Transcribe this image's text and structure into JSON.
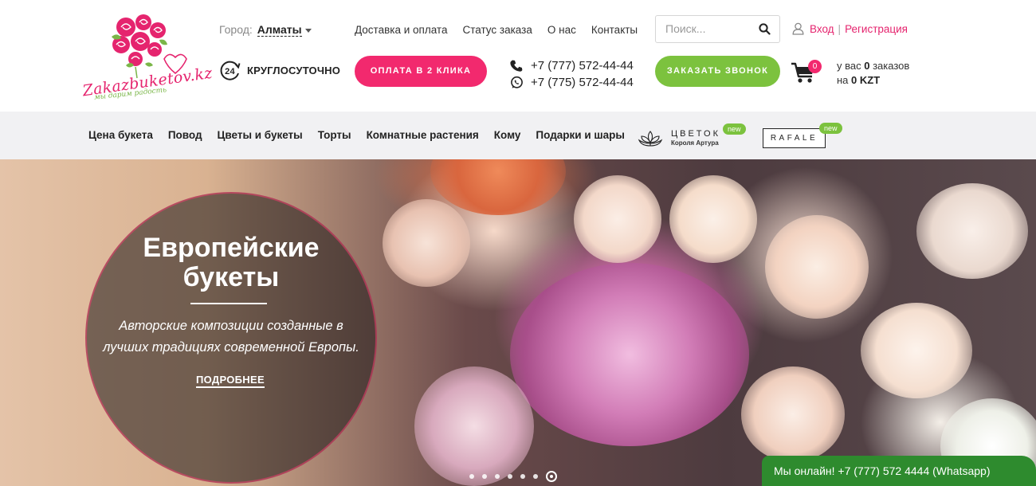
{
  "logo": {
    "name": "Zakazbuketov.kz",
    "slogan": "мы дарим радость"
  },
  "city": {
    "label": "Город:",
    "value": "Алматы"
  },
  "topnav": [
    "Доставка и оплата",
    "Статус заказа",
    "О нас",
    "Контакты"
  ],
  "search": {
    "placeholder": "Поиск..."
  },
  "auth": {
    "login": "Вход",
    "separator": "|",
    "register": "Регистрация"
  },
  "allday": {
    "badge": "24",
    "label": "КРУГЛОСУТОЧНО"
  },
  "buttons": {
    "pay": "ОПЛАТА В 2 КЛИКА",
    "call": "ЗАКАЗАТЬ ЗВОНОК"
  },
  "phones": [
    "+7 (777) 572-44-44",
    "+7 (775) 572-44-44"
  ],
  "cart": {
    "count": "0",
    "line1_prefix": "у вас ",
    "orders": "0",
    "line1_suffix": " заказов",
    "line2_prefix": "на ",
    "amount": "0 KZT"
  },
  "menu": [
    "Цена букета",
    "Повод",
    "Цветы и букеты",
    "Торты",
    "Комнатные растения",
    "Кому",
    "Подарки и шары"
  ],
  "brands": {
    "first": {
      "name": "ЦВЕТОК",
      "subtitle": "Короля Артура",
      "badge": "new"
    },
    "second": {
      "name": "RAFALE",
      "badge": "new"
    }
  },
  "hero": {
    "title_line1": "Европейские",
    "title_line2": "букеты",
    "text_line1": "Авторские композиции созданные в",
    "text_line2": "лучших традициях современной Европы.",
    "more": "ПОДРОБНЕЕ",
    "slide_count": 7,
    "active_slide": 7
  },
  "chat": {
    "text": "Мы онлайн! +7 (777) 572 4444 (Whatsapp)"
  },
  "colors": {
    "accent_pink": "#f2296e",
    "accent_green": "#7cc23e",
    "chat_green": "#2e8b2e",
    "menu_bg": "#f1f1f3"
  },
  "icons": [
    "rose-logo-icon",
    "caret-down-icon",
    "search-icon",
    "user-icon",
    "clock-24-icon",
    "phone-icon",
    "whatsapp-icon",
    "cart-icon",
    "lotus-icon"
  ]
}
